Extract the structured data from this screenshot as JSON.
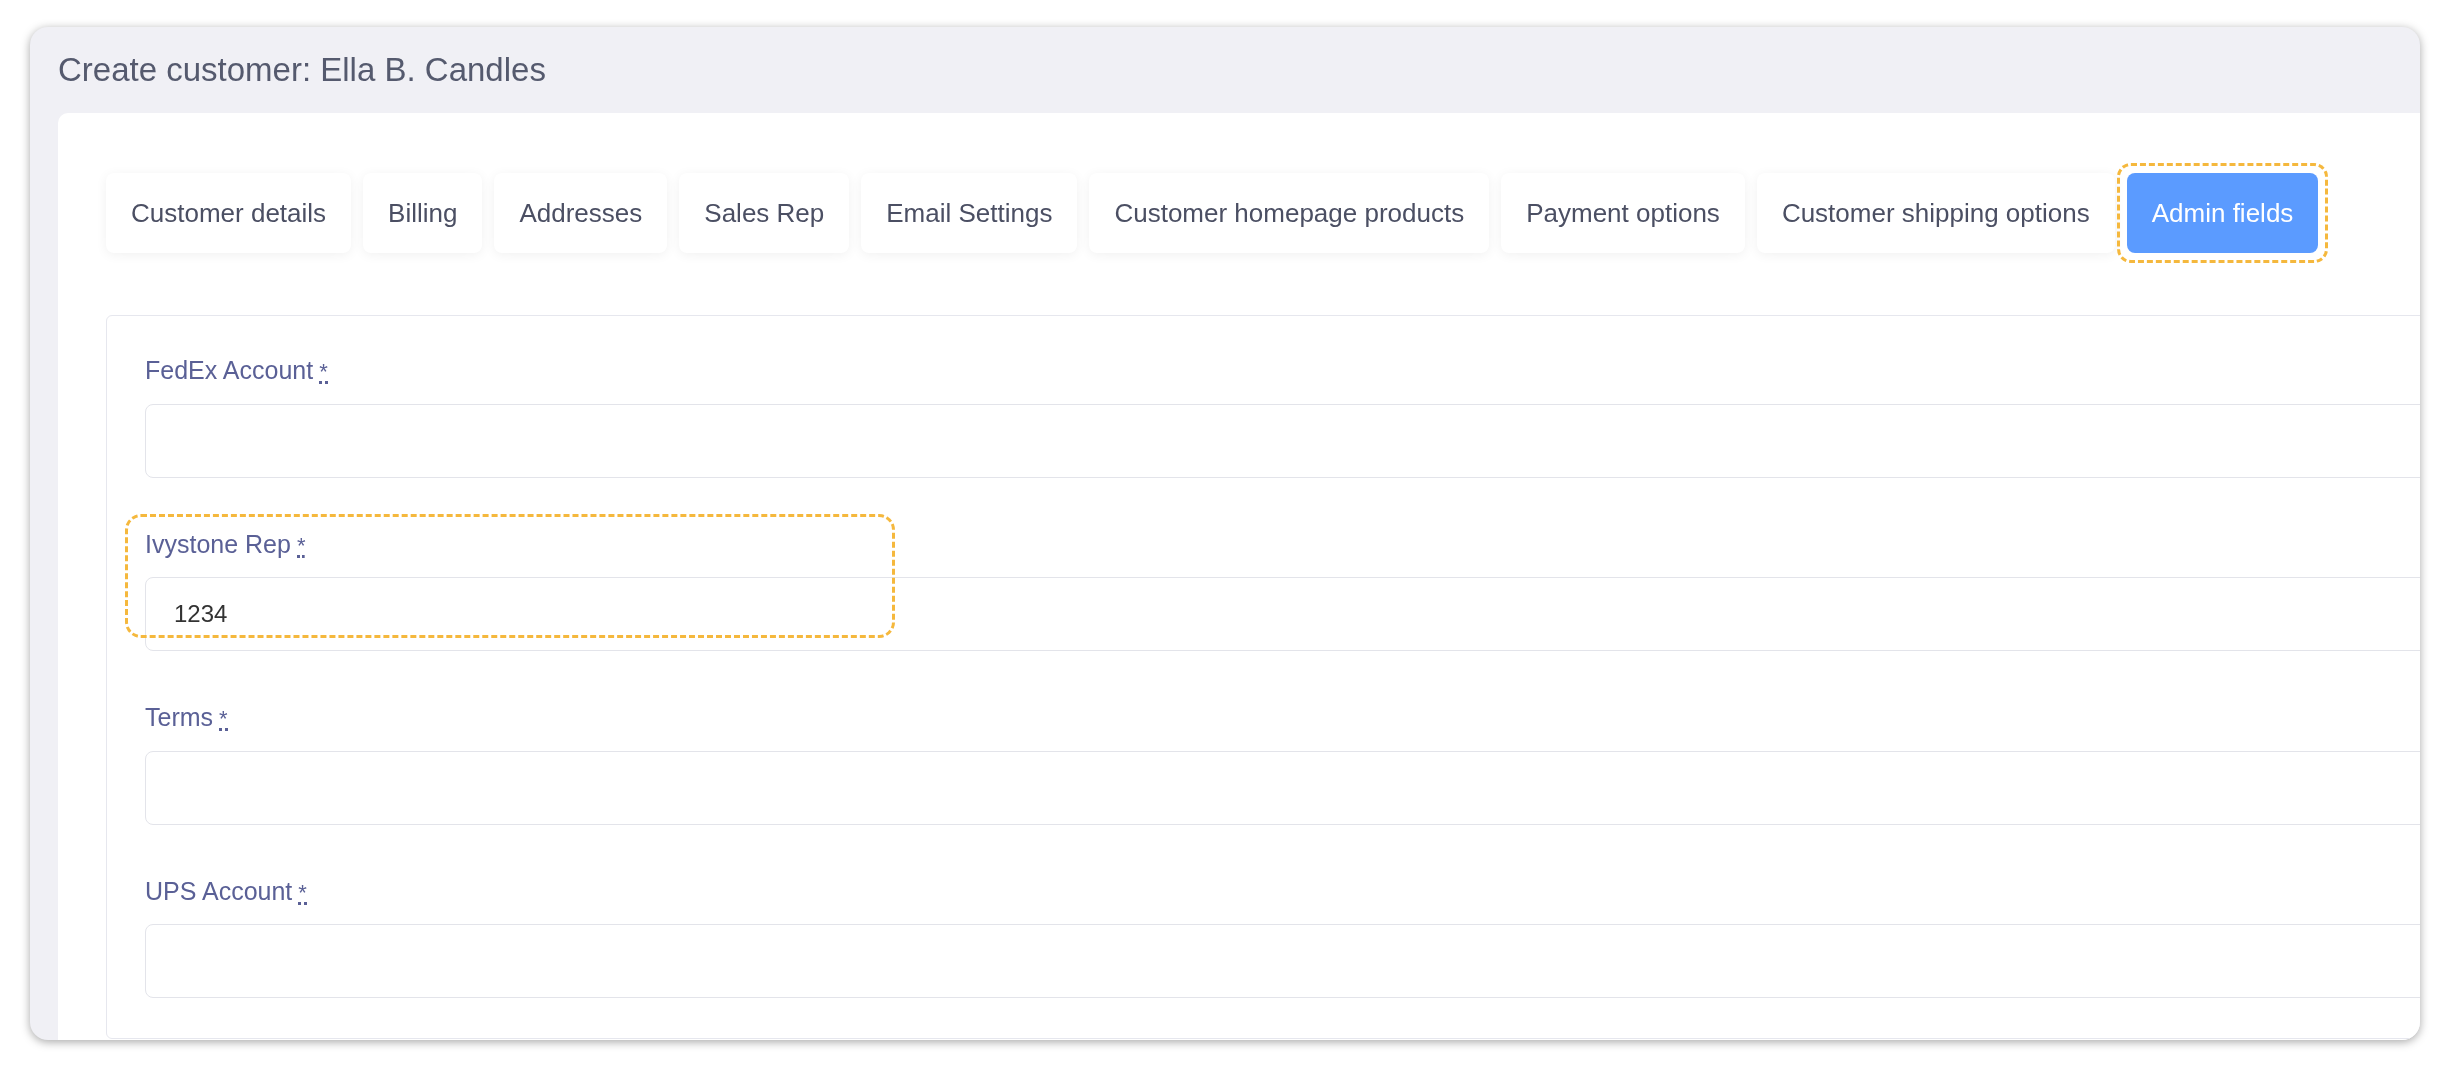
{
  "page": {
    "title": "Create customer: Ella B. Candles"
  },
  "tabs": [
    {
      "label": "Customer details",
      "selected": false,
      "highlighted": false
    },
    {
      "label": "Billing",
      "selected": false,
      "highlighted": false
    },
    {
      "label": "Addresses",
      "selected": false,
      "highlighted": false
    },
    {
      "label": "Sales Rep",
      "selected": false,
      "highlighted": false
    },
    {
      "label": "Email Settings",
      "selected": false,
      "highlighted": false
    },
    {
      "label": "Customer homepage products",
      "selected": false,
      "highlighted": false
    },
    {
      "label": "Payment options",
      "selected": false,
      "highlighted": false
    },
    {
      "label": "Customer shipping options",
      "selected": false,
      "highlighted": false
    },
    {
      "label": "Admin fields",
      "selected": true,
      "highlighted": true
    }
  ],
  "fields": [
    {
      "label": "FedEx Account",
      "required_mark": "*",
      "highlighted": false
    },
    {
      "label": "Ivystone Rep",
      "required_mark": "*",
      "value": "1234",
      "highlighted": true
    },
    {
      "label": "Terms",
      "required_mark": "*",
      "highlighted": false
    },
    {
      "label": "UPS Account",
      "required_mark": "*",
      "highlighted": false
    }
  ]
}
